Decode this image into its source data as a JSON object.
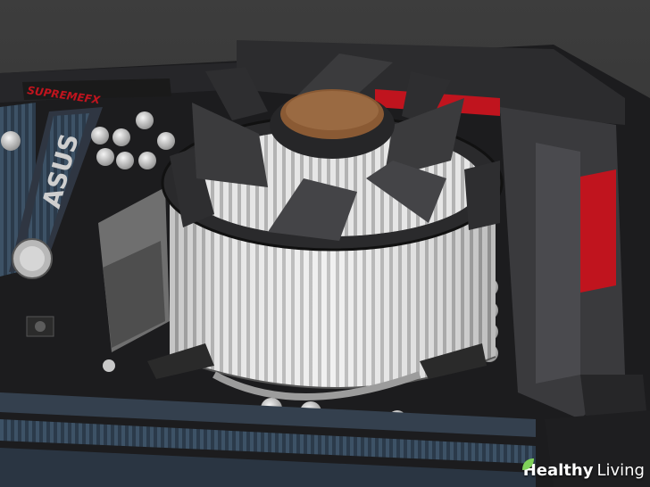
{
  "board": {
    "brand_label": "ASUS",
    "series_label": "SUPREMEFX"
  },
  "watermark": {
    "strong": "Healthy",
    "light": "Living"
  },
  "colors": {
    "background": "#3a3a3a",
    "board": "#1c1c1e",
    "accent_red": "#c0141e",
    "fin_light": "#e6e6e6",
    "fan_hub": "#8a5a34"
  }
}
